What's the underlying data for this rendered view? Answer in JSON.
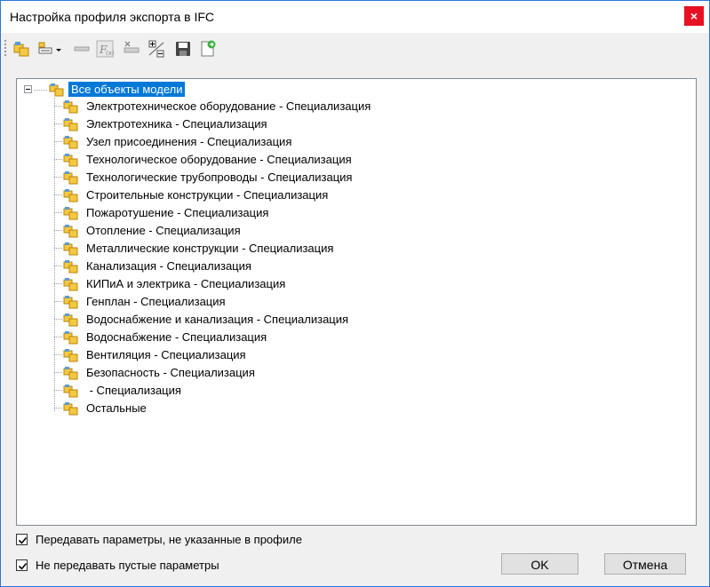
{
  "window": {
    "title": "Настройка профиля экспорта в IFC",
    "close_label": "×"
  },
  "toolbar": {
    "buttons": [
      {
        "name": "add-group-button",
        "icon": "folder-add-icon"
      },
      {
        "name": "add-parameter-dropdown-button",
        "icon": "parameter-add-icon"
      },
      {
        "name": "remove-button",
        "icon": "minus-icon"
      },
      {
        "name": "function-button",
        "icon": "function-icon"
      },
      {
        "name": "delete-parameter-button",
        "icon": "delete-parameter-icon"
      },
      {
        "name": "expand-collapse-button",
        "icon": "expand-collapse-icon"
      },
      {
        "name": "save-button",
        "icon": "save-icon"
      },
      {
        "name": "export-button",
        "icon": "document-go-icon"
      }
    ]
  },
  "tree": {
    "root": {
      "label": "Все объекты модели",
      "selected": true
    },
    "items": [
      "Электротехническое оборудование - Специализация",
      "Электротехника - Специализация",
      "Узел присоединения - Специализация",
      "Технологическое оборудование - Специализация",
      "Технологические трубопроводы - Специализация",
      "Строительные конструкции - Специализация",
      "Пожаротушение - Специализация",
      "Отопление - Специализация",
      "Металлические конструкции - Специализация",
      "Канализация - Специализация",
      "КИПиА и электрика - Специализация",
      "Генплан - Специализация",
      "Водоснабжение и канализация - Специализация",
      "Водоснабжение - Специализация",
      "Вентиляция - Специализация",
      "Безопасность - Специализация",
      " - Специализация",
      "Остальные"
    ]
  },
  "options": {
    "pass_unlisted_params": {
      "label": "Передавать параметры, не указанные в профиле",
      "checked": true
    },
    "skip_empty_params": {
      "label": "Не передавать пустые параметры",
      "checked": true
    }
  },
  "buttons": {
    "ok": "OK",
    "cancel": "Отмена"
  },
  "colors": {
    "selection": "#0078d7",
    "close": "#e81123",
    "folder": "#f5c842",
    "accent": "#2b78d6"
  }
}
